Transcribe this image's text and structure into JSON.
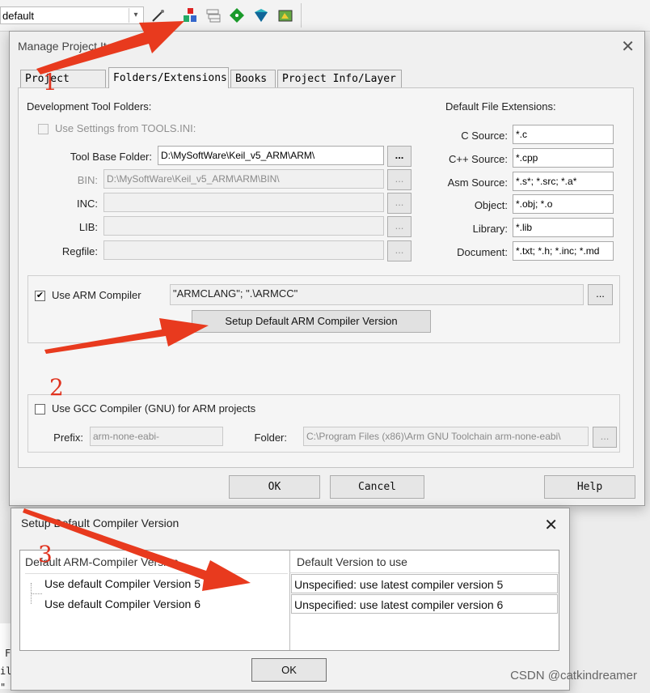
{
  "toolbar": {
    "target_value": "default",
    "icons": [
      "wand-icon",
      "manage-project-items-icon",
      "window-layers-icon",
      "green-diamond-icon",
      "pack-installer-icon",
      "select-packs-icon"
    ]
  },
  "manage_dialog": {
    "title": "Manage Project Items",
    "tabs": [
      "Project Items",
      "Folders/Extensions",
      "Books",
      "Project Info/Layer"
    ],
    "active_tab": "Folders/Extensions",
    "dev_tools": {
      "heading": "Development Tool Folders:",
      "use_settings_label": "Use Settings from TOOLS.INI:",
      "tool_base_label": "Tool Base Folder:",
      "tool_base_value": "D:\\MySoftWare\\Keil_v5_ARM\\ARM\\",
      "bin_label": "BIN:",
      "bin_value": "D:\\MySoftWare\\Keil_v5_ARM\\ARM\\BIN\\",
      "inc_label": "INC:",
      "lib_label": "LIB:",
      "regfile_label": "Regfile:",
      "browse": "..."
    },
    "extensions": {
      "heading": "Default File Extensions:",
      "rows": [
        {
          "label": "C Source:",
          "value": "*.c"
        },
        {
          "label": "C++ Source:",
          "value": "*.cpp"
        },
        {
          "label": "Asm Source:",
          "value": "*.s*; *.src; *.a*"
        },
        {
          "label": "Object:",
          "value": "*.obj; *.o"
        },
        {
          "label": "Library:",
          "value": "*.lib"
        },
        {
          "label": "Document:",
          "value": "*.txt; *.h; *.inc; *.md"
        }
      ]
    },
    "arm": {
      "use_label": "Use ARM Compiler",
      "value": "\"ARMCLANG\"; \".\\ARMCC\"",
      "setup_button": "Setup Default ARM Compiler Version"
    },
    "gcc": {
      "use_label": "Use GCC Compiler (GNU) for ARM projects",
      "prefix_label": "Prefix:",
      "prefix_value": "arm-none-eabi-",
      "folder_label": "Folder:",
      "folder_value": "C:\\Program Files (x86)\\Arm GNU Toolchain arm-none-eabi\\"
    },
    "buttons": {
      "ok": "OK",
      "cancel": "Cancel",
      "help": "Help"
    }
  },
  "version_dialog": {
    "title": "Setup Default Compiler Version",
    "col1": "Default ARM-Compiler Version",
    "col2": "Default Version to use",
    "rows": [
      {
        "name": "Use default Compiler Version 5",
        "value": "Unspecified: use latest compiler version 5"
      },
      {
        "name": "Use default Compiler Version 6",
        "value": "Unspecified: use latest compiler version 6"
      }
    ],
    "ok": "OK"
  },
  "annotations": [
    "1",
    "2",
    "3"
  ],
  "background_text": [
    "F",
    "il",
    "\""
  ],
  "watermark": "CSDN @catkindreamer",
  "colors": {
    "arrow": "#e83a1e",
    "dialog_bg": "#f0f0f0"
  }
}
